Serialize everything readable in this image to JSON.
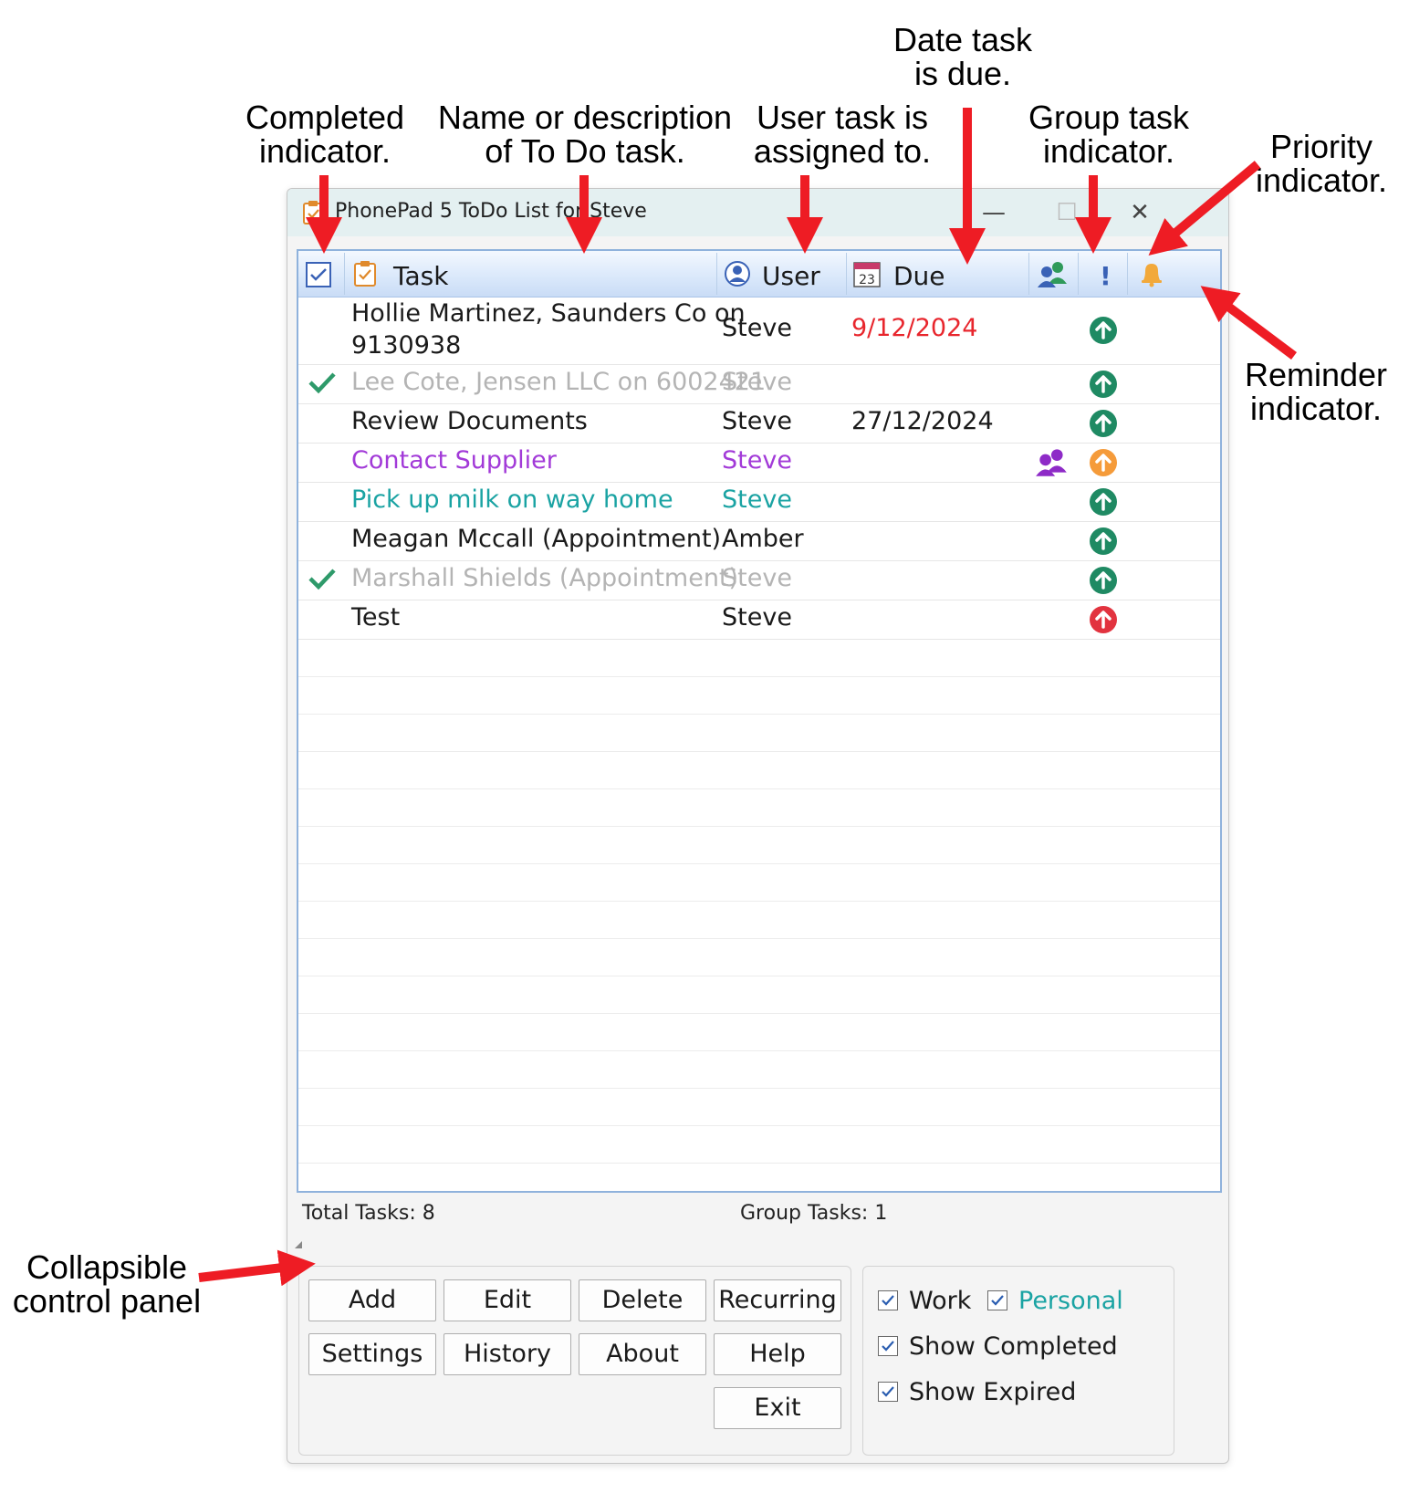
{
  "annotations": {
    "completed": "Completed\nindicator.",
    "name": "Name or description\nof To Do task.",
    "user": "User task is\nassigned to.",
    "due": "Date task\nis due.",
    "group": "Group task\nindicator.",
    "priority": "Priority\nindicator.",
    "reminder": "Reminder\nindicator.",
    "panel": "Collapsible\ncontrol panel"
  },
  "window": {
    "title": "PhonePad 5 ToDo List for Steve",
    "minimize": "—",
    "maximize": "☐",
    "close": "✕"
  },
  "grid": {
    "headers": {
      "task": "Task",
      "user": "User",
      "due": "Due",
      "calendar_day": "23",
      "priority": "!"
    },
    "rows": [
      {
        "completed": false,
        "task": "Hollie Martinez, Saunders Co on",
        "task2": "9130938",
        "user": "Steve",
        "due": "9/12/2024",
        "due_color": "#e8262d",
        "text_color": "#1a1a1a",
        "group": false,
        "priority": "normal",
        "priority_color": "#1f8a63"
      },
      {
        "completed": true,
        "task": "Lee Cote, Jensen LLC on 6002421",
        "user": "Steve",
        "due": "",
        "text_color": "#b4b4b4",
        "group": false,
        "priority": "normal",
        "priority_color": "#1f8a63"
      },
      {
        "completed": false,
        "task": "Review Documents",
        "user": "Steve",
        "due": "27/12/2024",
        "due_color": "#1a1a1a",
        "text_color": "#1a1a1a",
        "group": false,
        "priority": "normal",
        "priority_color": "#1f8a63"
      },
      {
        "completed": false,
        "task": "Contact Supplier",
        "user": "Steve",
        "due": "",
        "text_color": "#a23ad8",
        "group": true,
        "group_color": "#8e2ac7",
        "priority": "medium",
        "priority_color": "#f59b3a"
      },
      {
        "completed": false,
        "task": "Pick up milk on way home",
        "user": "Steve",
        "due": "",
        "text_color": "#1aa3a3",
        "group": false,
        "priority": "normal",
        "priority_color": "#1f8a63"
      },
      {
        "completed": false,
        "task": "Meagan Mccall (Appointment)",
        "user": "Amber",
        "due": "",
        "text_color": "#1a1a1a",
        "group": false,
        "priority": "normal",
        "priority_color": "#1f8a63"
      },
      {
        "completed": true,
        "task": "Marshall Shields (Appointment)",
        "user": "Steve",
        "due": "",
        "text_color": "#b4b4b4",
        "group": false,
        "priority": "normal",
        "priority_color": "#1f8a63"
      },
      {
        "completed": false,
        "task": "Test",
        "user": "Steve",
        "due": "",
        "text_color": "#1a1a1a",
        "group": false,
        "priority": "high",
        "priority_color": "#e2333f"
      }
    ]
  },
  "status": {
    "total": "Total Tasks: 8",
    "group": "Group Tasks: 1"
  },
  "buttons": [
    "Add",
    "Edit",
    "Delete",
    "Recurring",
    "Settings",
    "History",
    "About",
    "Help",
    "Exit"
  ],
  "filters": [
    {
      "label": "Work",
      "checked": true,
      "color": "#1a1a1a"
    },
    {
      "label": "Personal",
      "checked": true,
      "color": "#1aa3a3"
    },
    {
      "label": "Show Completed",
      "checked": true,
      "color": "#1a1a1a"
    },
    {
      "label": "Show Expired",
      "checked": true,
      "color": "#1a1a1a"
    }
  ],
  "colors": {
    "arrow": "#ee1c24",
    "header_accent": "#8fb2dc",
    "check_green": "#2e9a6a"
  },
  "icons": [
    "clipboard-check-icon",
    "checkbox-icon",
    "user-circle-icon",
    "calendar-icon",
    "group-icon",
    "exclamation-icon",
    "bell-icon",
    "arrow-up-circle-icon",
    "checkmark-icon",
    "collapse-triangle-icon"
  ]
}
